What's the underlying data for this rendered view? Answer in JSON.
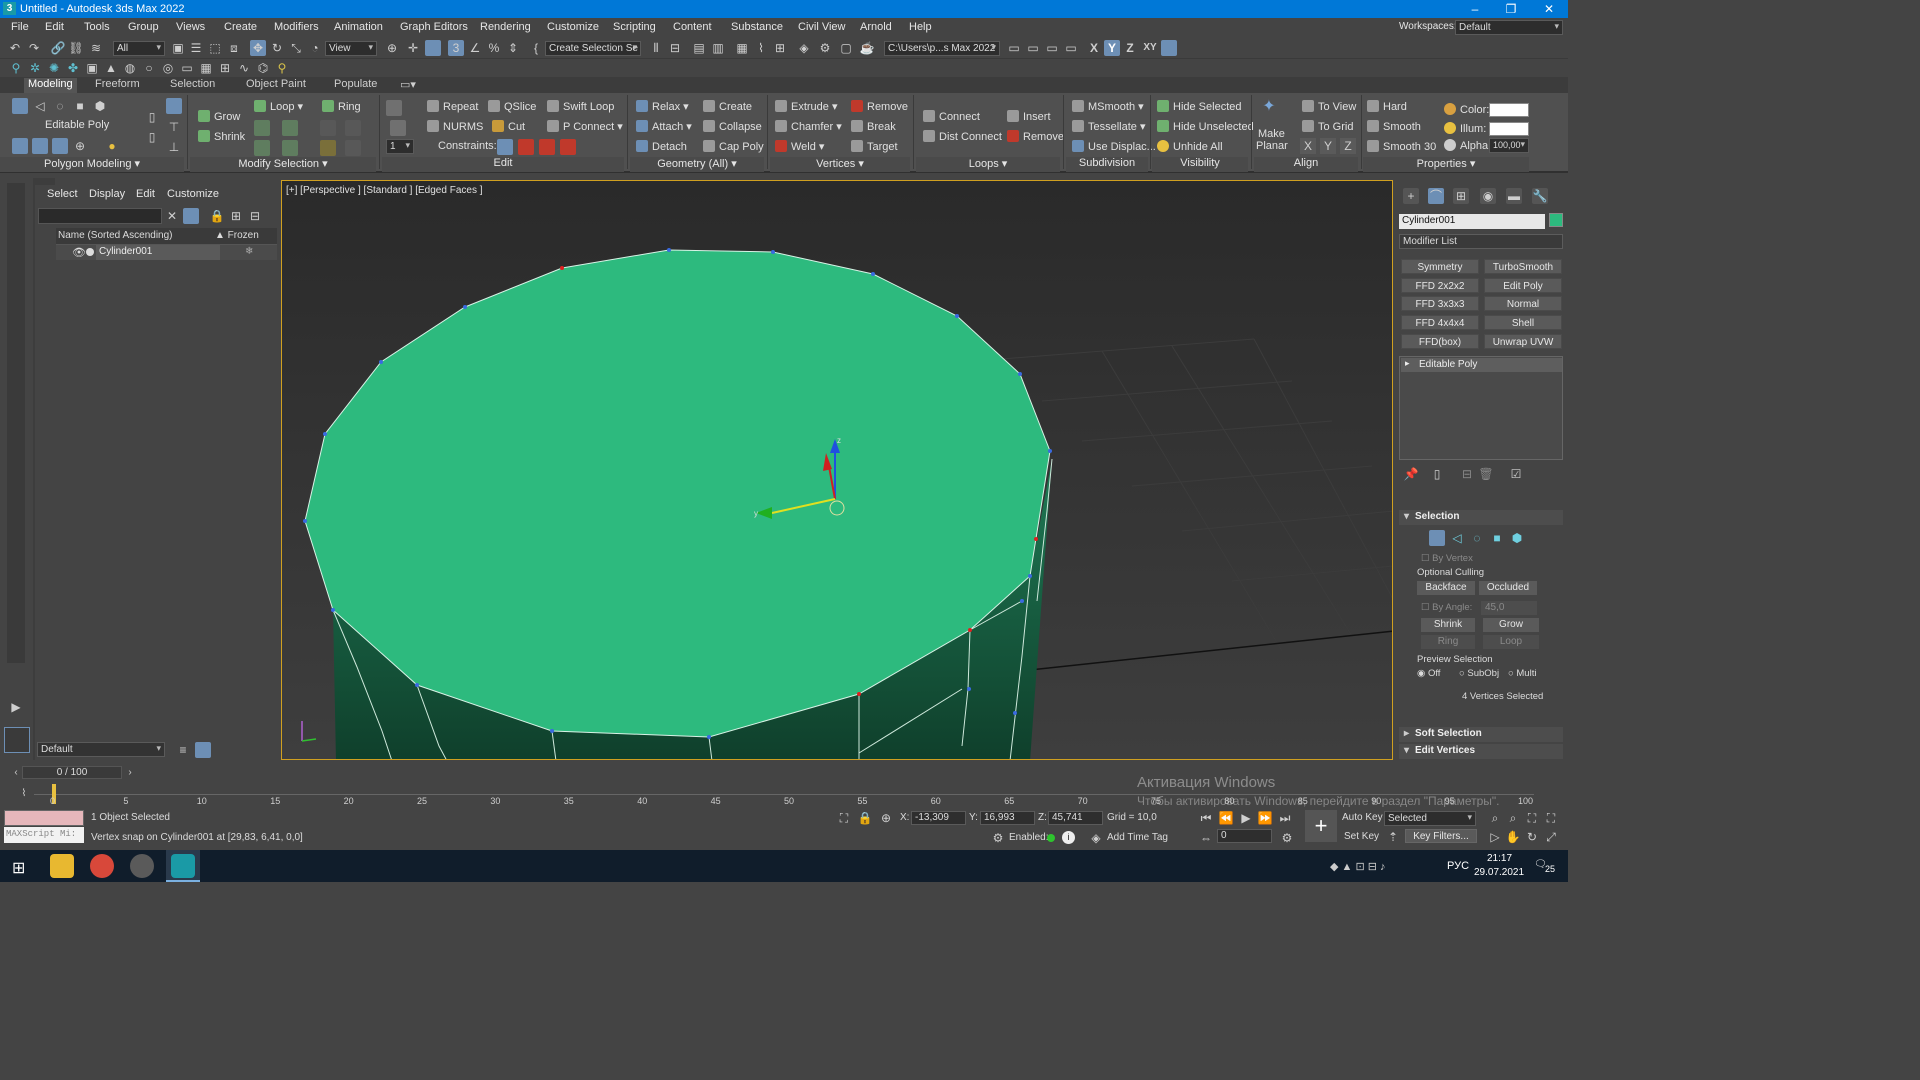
{
  "window": {
    "title": "Untitled - Autodesk 3ds Max 2022",
    "app_icon": "3"
  },
  "menu": [
    "File",
    "Edit",
    "Tools",
    "Group",
    "Views",
    "Create",
    "Modifiers",
    "Animation",
    "Graph Editors",
    "Rendering",
    "Customize",
    "Scripting",
    "Content",
    "Substance",
    "Civil View",
    "Arnold",
    "Help"
  ],
  "workspace": {
    "label": "Workspaces:",
    "value": "Default"
  },
  "toolbar": {
    "filter": "All",
    "ref_coord": "View",
    "selection_set": "Create Selection Se",
    "project_path": "C:\\Users\\p...s Max 2022",
    "axes": [
      "X",
      "Y",
      "Z",
      "XY"
    ]
  },
  "ribbon_tabs": [
    "Modeling",
    "Freeform",
    "Selection",
    "Object Paint",
    "Populate"
  ],
  "ribbon": {
    "editable_poly": "Editable Poly",
    "polygon_modeling": "Polygon Modeling",
    "modify_selection": {
      "grow": "Grow",
      "shrink": "Shrink",
      "loop": "Loop",
      "ring": "Ring",
      "title": "Modify Selection"
    },
    "edit": {
      "repeat": "Repeat",
      "qslice": "QSlice",
      "swift_loop": "Swift Loop",
      "nurms": "NURMS",
      "cut": "Cut",
      "p_connect": "P Connect",
      "constraints": "Constraints:",
      "spinner": "1",
      "title": "Edit"
    },
    "geometry": {
      "relax": "Relax",
      "create": "Create",
      "attach": "Attach",
      "collapse": "Collapse",
      "detach": "Detach",
      "cap_poly": "Cap Poly",
      "title": "Geometry (All)"
    },
    "vertices": {
      "extrude": "Extrude",
      "remove": "Remove",
      "chamfer": "Chamfer",
      "break": "Break",
      "weld": "Weld",
      "target": "Target",
      "title": "Vertices"
    },
    "loops": {
      "connect": "Connect",
      "dist_connect": "Dist Connect",
      "insert": "Insert",
      "remove": "Remove",
      "title": "Loops"
    },
    "subdivision": {
      "msmooth": "MSmooth",
      "tessellate": "Tessellate",
      "use_displac": "Use Displac...",
      "title": "Subdivision"
    },
    "visibility": {
      "hide_selected": "Hide Selected",
      "hide_unselected": "Hide Unselected",
      "unhide_all": "Unhide All",
      "title": "Visibility"
    },
    "align": {
      "make_planar_1": "Make",
      "make_planar_2": "Planar",
      "to_view": "To View",
      "to_grid": "To Grid",
      "x": "X",
      "y": "Y",
      "z": "Z",
      "title": "Align"
    },
    "smoothing": {
      "hard": "Hard",
      "smooth": "Smooth",
      "smooth30": "Smooth 30"
    },
    "properties": {
      "color": "Color:",
      "illum": "Illum:",
      "alpha": "Alpha:",
      "alpha_value": "100,00",
      "title": "Properties"
    }
  },
  "scene_explorer": {
    "menu": [
      "Select",
      "Display",
      "Edit",
      "Customize"
    ],
    "col_name": "Name (Sorted Ascending)",
    "col_frozen": "▲ Frozen",
    "objects": [
      {
        "name": "Cylinder001"
      }
    ],
    "layer": "Default"
  },
  "viewport": {
    "label": "[+] [Perspective ] [Standard ] [Edged Faces ]",
    "object_color": "#2dba7e",
    "selection_color": "#d0a020"
  },
  "command_panel": {
    "object_name": "Cylinder001",
    "object_color": "#2dba7e",
    "modifier_list": "Modifier List",
    "modifier_buttons": [
      [
        "Symmetry",
        "TurboSmooth"
      ],
      [
        "FFD 2x2x2",
        "Edit Poly"
      ],
      [
        "FFD 3x3x3",
        "Normal"
      ],
      [
        "FFD 4x4x4",
        "Shell"
      ],
      [
        "FFD(box)",
        "Unwrap UVW"
      ]
    ],
    "stack": [
      "Editable Poly"
    ],
    "selection": {
      "title": "Selection",
      "by_vertex": "By Vertex",
      "optional_culling": "Optional Culling",
      "backface": "Backface",
      "occluded": "Occluded",
      "by_angle": "By Angle:",
      "by_angle_value": "45,0",
      "shrink": "Shrink",
      "grow": "Grow",
      "ring": "Ring",
      "loop": "Loop",
      "preview_selection": "Preview Selection",
      "off": "Off",
      "subobj": "SubObj",
      "multi": "Multi",
      "status": "4 Vertices Selected"
    },
    "soft_selection": "Soft Selection",
    "edit_vertices": "Edit Vertices"
  },
  "timeline": {
    "frame": "0 / 100",
    "ticks": [
      "0",
      "5",
      "10",
      "15",
      "20",
      "25",
      "30",
      "35",
      "40",
      "45",
      "50",
      "55",
      "60",
      "65",
      "70",
      "75",
      "80",
      "85",
      "90",
      "95",
      "100"
    ]
  },
  "status": {
    "selected": "1 Object Selected",
    "prompt": "Vertex snap on Cylinder001 at [29,83, 6,41, 0,0]",
    "maxscript": "MAXScript Mi:",
    "x": "-13,309",
    "y": "16,993",
    "z": "45,741",
    "grid": "Grid = 10,0",
    "enabled": "Enabled:",
    "add_time_tag": "Add Time Tag",
    "auto_key": "Auto Key",
    "set_key": "Set Key",
    "selected_mode": "Selected",
    "key_filters": "Key Filters...",
    "frame_field": "0"
  },
  "watermark": {
    "line1": "Активация Windows",
    "line2": "Чтобы активировать Windows, перейдите в раздел \"Параметры\"."
  },
  "taskbar": {
    "lang": "РУС",
    "time": "21:17",
    "date": "29.07.2021",
    "notif": "25"
  }
}
